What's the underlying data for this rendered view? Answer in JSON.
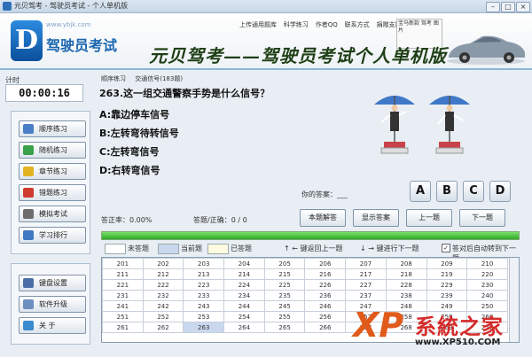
{
  "window": {
    "title": "元贝驾考 - 驾驶员考试 - 个人单机版"
  },
  "banner": {
    "logo_letter": "D",
    "logo_sub": "www.ybjk.com",
    "logo_title": "驾驶员考试",
    "slogan": "元贝驾考——驾驶员考试个人单机版",
    "links": [
      "上传通用题库",
      "科学练习",
      "作者QQ",
      "联系方式",
      "捐赠支持"
    ],
    "minibox": "宝马新款 驾考 图片"
  },
  "timer": {
    "label": "计时",
    "value": "00:00:16"
  },
  "nav": {
    "group1": [
      {
        "label": "顺序练习",
        "icon": "list-icon",
        "color": "#4a7ec6"
      },
      {
        "label": "随机练习",
        "icon": "shuffle-icon",
        "color": "#3aa14a"
      },
      {
        "label": "章节练习",
        "icon": "folder-icon",
        "color": "#e2b321"
      },
      {
        "label": "错题练习",
        "icon": "flag-icon",
        "color": "#d13a2f"
      },
      {
        "label": "模拟考试",
        "icon": "exam-icon",
        "color": "#6d6d6d"
      },
      {
        "label": "学习排行",
        "icon": "chart-icon",
        "color": "#3f79c2"
      }
    ],
    "group2": [
      {
        "label": "键盘设置",
        "icon": "keyboard-icon",
        "color": "#4a6fa8"
      },
      {
        "label": "软件升级",
        "icon": "upgrade-icon",
        "color": "#6b8fbf"
      },
      {
        "label": "关 于",
        "icon": "info-icon",
        "color": "#3a8bd0"
      }
    ]
  },
  "question": {
    "tabs": [
      "顺序练习",
      "交通信号(183题)"
    ],
    "text": "263.这一组交通警察手势是什么信号？",
    "options": [
      "A:靠边停车信号",
      "B:左转弯待转信号",
      "C:左转弯信号",
      "D:右转弯信号"
    ]
  },
  "answer": {
    "label": "你的答案：___",
    "buttons": [
      "A",
      "B",
      "C",
      "D"
    ]
  },
  "stats": {
    "correct_rate": "答正率：0.00%",
    "answered": "答题/正确：0 / 0"
  },
  "actions": [
    "本题解答",
    "显示答案",
    "上一题",
    "下一题"
  ],
  "progress": {
    "fraction": 1.0
  },
  "legend": {
    "unanswered": "未答题",
    "current": "当前题",
    "answered": "已答题",
    "prev_key": "↑ ← 键返回上一题",
    "next_key": "↓ → 键进行下一题",
    "auto_next": "答对后自动转到下一题"
  },
  "grid": {
    "current": "263",
    "rows": [
      [
        "201",
        "202",
        "203",
        "204",
        "205",
        "206",
        "207",
        "208",
        "209",
        "210"
      ],
      [
        "211",
        "212",
        "213",
        "214",
        "215",
        "216",
        "217",
        "218",
        "219",
        "220"
      ],
      [
        "221",
        "222",
        "223",
        "224",
        "225",
        "226",
        "227",
        "228",
        "229",
        "230"
      ],
      [
        "231",
        "232",
        "233",
        "234",
        "235",
        "236",
        "237",
        "238",
        "239",
        "240"
      ],
      [
        "241",
        "242",
        "243",
        "244",
        "245",
        "246",
        "247",
        "248",
        "249",
        "250"
      ],
      [
        "251",
        "252",
        "253",
        "254",
        "255",
        "256",
        "257",
        "258",
        "259",
        "260"
      ],
      [
        "261",
        "262",
        "263",
        "264",
        "265",
        "266",
        "267",
        "268",
        "269",
        "270"
      ]
    ]
  },
  "watermark": {
    "xp": "XP",
    "cn": "系統之家",
    "url": "www.XP510.COM"
  },
  "colors": {
    "accent": "#1c66b0",
    "progress": "#2ea829",
    "banner_border": "#8cb5d9"
  }
}
